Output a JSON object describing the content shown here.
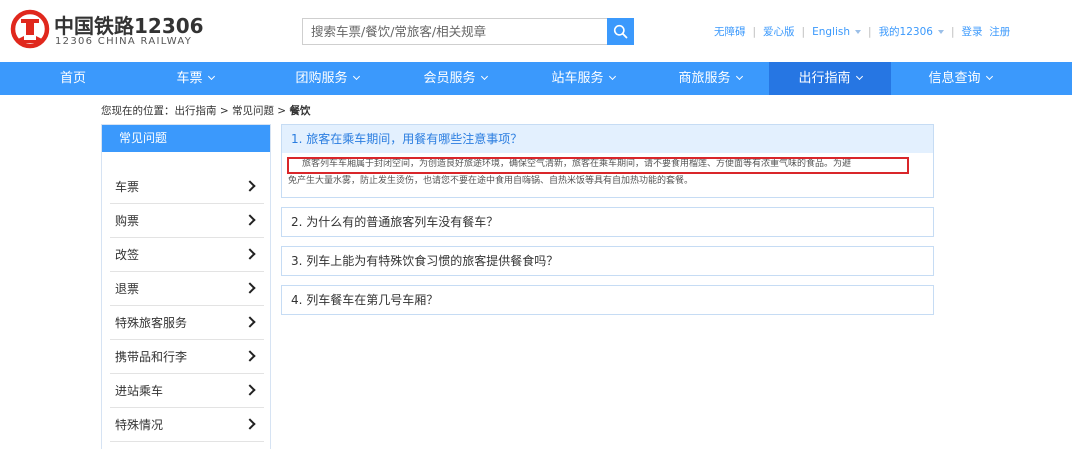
{
  "header": {
    "brand_cn": "中国铁路12306",
    "brand_en": "12306 CHINA RAILWAY",
    "search_placeholder": "搜索车票/餐饮/常旅客/相关规章",
    "links": {
      "accessible": "无障碍",
      "care": "爱心版",
      "language": "English",
      "my": "我的12306",
      "login": "登录",
      "register": "注册"
    }
  },
  "colors": {
    "accent": "#3b99fc",
    "nav_active": "#2676e3",
    "highlight": "#d9262a"
  },
  "nav": {
    "items": [
      "首页",
      "车票",
      "团购服务",
      "会员服务",
      "站车服务",
      "商旅服务",
      "出行指南",
      "信息查询"
    ],
    "active": "出行指南"
  },
  "breadcrumb": {
    "prefix": "您现在的位置：",
    "path": "出行指南 > 常见问题 > ",
    "current": "餐饮"
  },
  "sidebar": {
    "title": "常见问题",
    "items": [
      "车票",
      "购票",
      "改签",
      "退票",
      "特殊旅客服务",
      "携带品和行李",
      "进站乘车",
      "特殊情况"
    ]
  },
  "faqs": [
    {
      "title": "1. 旅客在乘车期间，用餐有哪些注意事项？",
      "answer_line1": "旅客列车车厢属于封闭空间，为创造良好旅途环境，确保空气清新，旅客在乘车期间，请不要食用榴莲、方便面等有浓重气味的食品。为避",
      "answer_line2": "免产生大量水雾，防止发生烫伤，也请您不要在途中食用自嗨锅、自热米饭等具有自加热功能的套餐。"
    },
    {
      "title": "2. 为什么有的普通旅客列车没有餐车？"
    },
    {
      "title": "3. 列车上能为有特殊饮食习惯的旅客提供餐食吗？"
    },
    {
      "title": "4. 列车餐车在第几号车厢？"
    }
  ]
}
